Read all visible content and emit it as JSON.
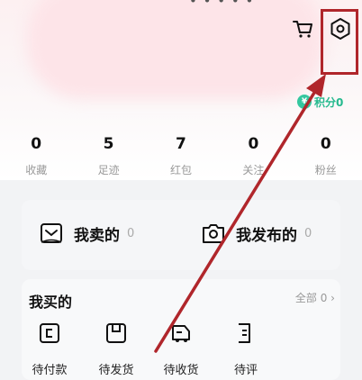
{
  "header": {
    "partial_text": "• • • • •",
    "cart_icon": "cart-icon",
    "settings_icon": "settings-icon"
  },
  "points": {
    "label": "积分0",
    "icon": "coin-icon",
    "coin_glyph": "¥"
  },
  "stats": [
    {
      "value": "0",
      "label": "收藏"
    },
    {
      "value": "5",
      "label": "足迹"
    },
    {
      "value": "7",
      "label": "红包"
    },
    {
      "value": "0",
      "label": "关注"
    },
    {
      "value": "0",
      "label": "粉丝"
    }
  ],
  "seller_card": {
    "sold": {
      "label": "我卖的",
      "count": "0",
      "icon": "sold-box-icon"
    },
    "published": {
      "label": "我发布的",
      "count": "0",
      "icon": "camera-icon"
    }
  },
  "orders": {
    "title": "我买的",
    "all_label": "全部 0 ›",
    "items": [
      {
        "label": "待付款",
        "icon": "wallet-icon"
      },
      {
        "label": "待发货",
        "icon": "package-icon"
      },
      {
        "label": "待收货",
        "icon": "truck-icon"
      },
      {
        "label": "待评",
        "icon": "review-icon"
      }
    ]
  },
  "colors": {
    "annotation_red": "#b0262b",
    "accent_green": "#34c79f"
  }
}
